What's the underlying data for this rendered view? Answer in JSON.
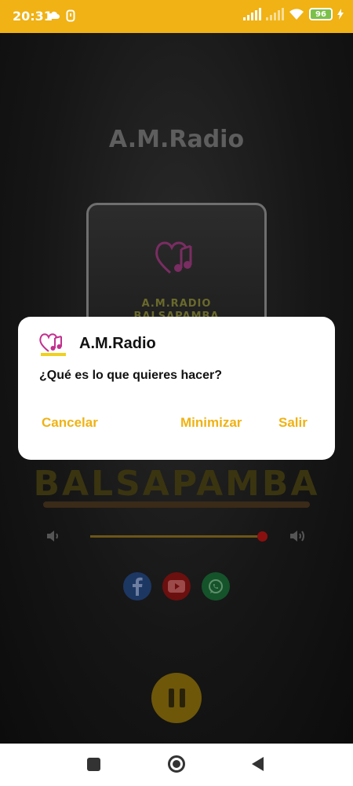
{
  "status_bar": {
    "time": "20:31",
    "battery": "96",
    "icons": [
      "cloud-icon",
      "app-notification-icon",
      "signal-icon",
      "signal-icon",
      "wifi-icon",
      "battery-icon",
      "charging-icon"
    ]
  },
  "app": {
    "title": "A.M.Radio",
    "cover": {
      "line1": "A.M.RADIO",
      "line2": "BALSAPAMBA"
    },
    "volume": {
      "level": 0.95
    },
    "social": [
      "facebook-icon",
      "youtube-icon",
      "whatsapp-icon"
    ],
    "playback_state": "playing"
  },
  "dialog": {
    "title": "A.M.Radio",
    "message": "¿Qué es lo que quieres hacer?",
    "buttons": {
      "cancel": "Cancelar",
      "minimize": "Minimizar",
      "exit": "Salir"
    }
  },
  "colors": {
    "accent": "#F0B214",
    "dialog_bg": "#FFFFFF",
    "text": "#111111"
  }
}
